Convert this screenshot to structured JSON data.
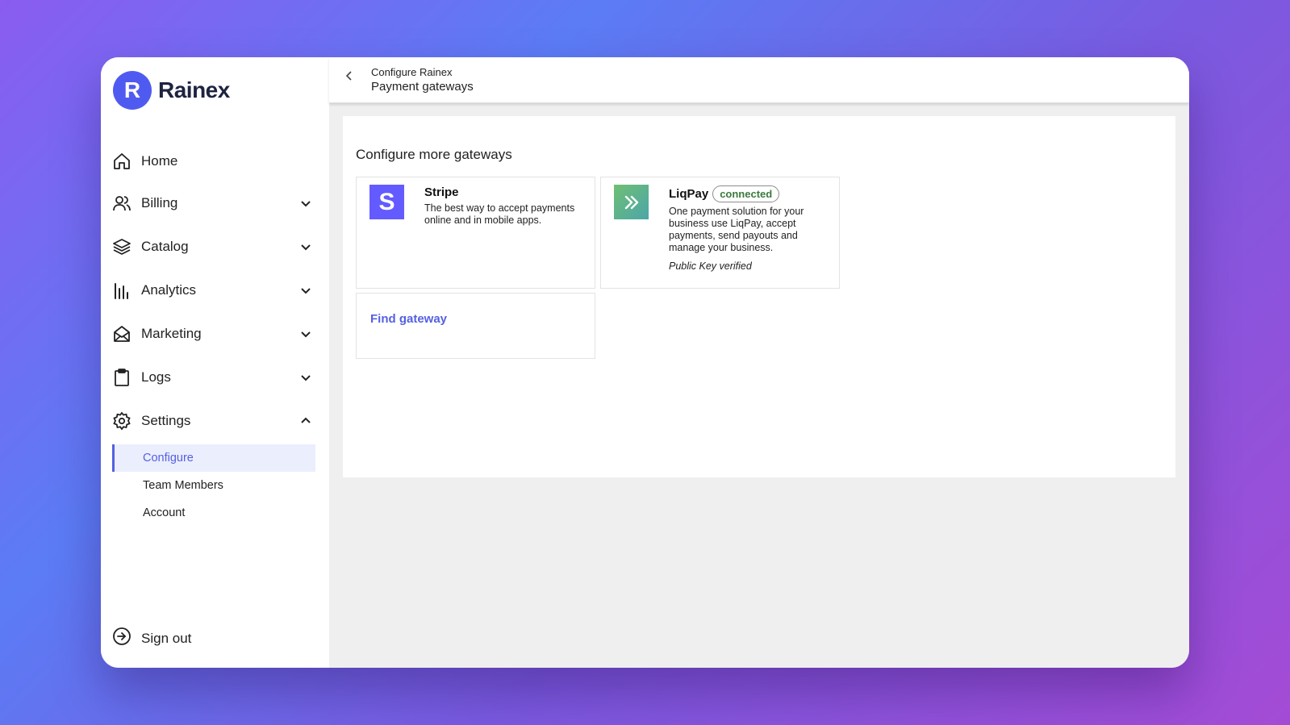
{
  "brand": {
    "logo_letter": "R",
    "name": "Rainex",
    "accent": "#4f5bf0"
  },
  "sidebar": {
    "items": [
      {
        "label": "Home",
        "icon": "home-icon"
      },
      {
        "label": "Billing",
        "icon": "users-icon",
        "expandable": true
      },
      {
        "label": "Catalog",
        "icon": "layers-icon",
        "expandable": true
      },
      {
        "label": "Analytics",
        "icon": "bar-chart-icon",
        "expandable": true
      },
      {
        "label": "Marketing",
        "icon": "mail-icon",
        "expandable": true
      },
      {
        "label": "Logs",
        "icon": "clipboard-icon",
        "expandable": true
      },
      {
        "label": "Settings",
        "icon": "gear-icon",
        "expanded": true
      }
    ],
    "settings_sub": [
      {
        "label": "Configure",
        "active": true
      },
      {
        "label": "Team Members"
      },
      {
        "label": "Account"
      }
    ],
    "signout": {
      "label": "Sign out",
      "icon": "sign-out-icon"
    }
  },
  "header": {
    "parent": "Configure Rainex",
    "title": "Payment gateways"
  },
  "main": {
    "section_title": "Configure more gateways",
    "gateways": [
      {
        "name": "Stripe",
        "logo_letter": "S",
        "logo_color": "#635bff",
        "description": "The best way to accept payments online and in mobile apps."
      },
      {
        "name": "LiqPay",
        "status": "connected",
        "description": "One payment solution for your business use LiqPay, accept payments, send payouts and manage your business.",
        "note": "Public Key verified"
      }
    ],
    "find_gateway": "Find gateway"
  }
}
